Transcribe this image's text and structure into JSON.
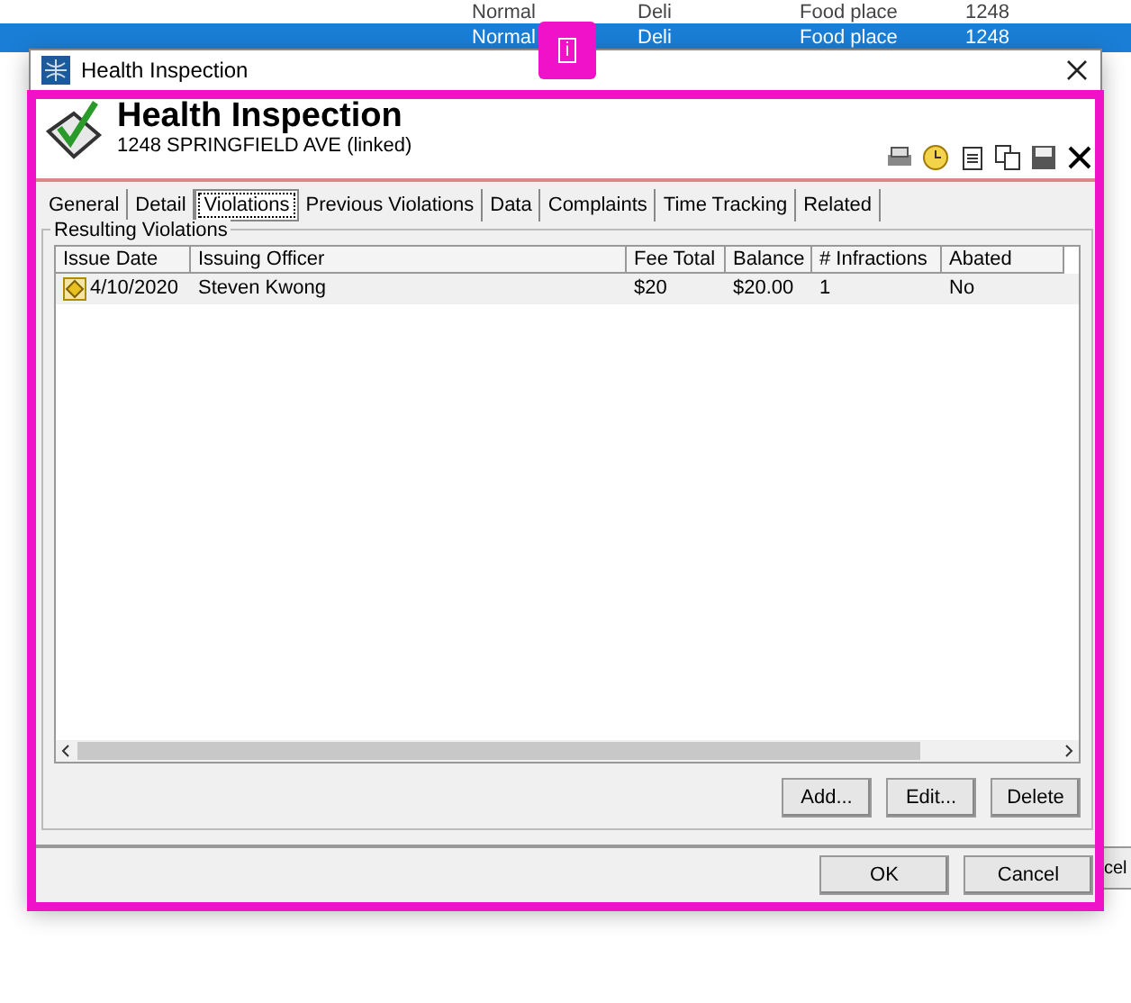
{
  "background_list": {
    "rows": [
      {
        "cells": [
          "Normal",
          "Deli",
          "Food place",
          "1248"
        ],
        "selected": false
      },
      {
        "cells": [
          "Normal",
          "Deli",
          "Food place",
          "1248"
        ],
        "selected": true
      }
    ],
    "partial_button": "cel"
  },
  "window": {
    "title": "Health Inspection"
  },
  "header": {
    "title": "Health Inspection",
    "subtitle": "1248 SPRINGFIELD AVE (linked)"
  },
  "tabs": [
    {
      "label": "General",
      "selected": false
    },
    {
      "label": "Detail",
      "selected": false
    },
    {
      "label": "Violations",
      "selected": true
    },
    {
      "label": "Previous Violations",
      "selected": false
    },
    {
      "label": "Data",
      "selected": false
    },
    {
      "label": "Complaints",
      "selected": false
    },
    {
      "label": "Time Tracking",
      "selected": false
    },
    {
      "label": "Related",
      "selected": false
    }
  ],
  "group": {
    "title": "Resulting Violations"
  },
  "table": {
    "columns": [
      "Issue Date",
      "Issuing Officer",
      "Fee Total",
      "Balance",
      "# Infractions",
      "Abated"
    ],
    "rows": [
      {
        "cells": [
          "4/10/2020",
          "Steven Kwong",
          "$20",
          "$20.00",
          "1",
          "No"
        ]
      }
    ]
  },
  "list_buttons": [
    "Add...",
    "Edit...",
    "Delete"
  ],
  "dialog_buttons": [
    "OK",
    "Cancel"
  ],
  "annotation": {
    "badge": "i"
  }
}
